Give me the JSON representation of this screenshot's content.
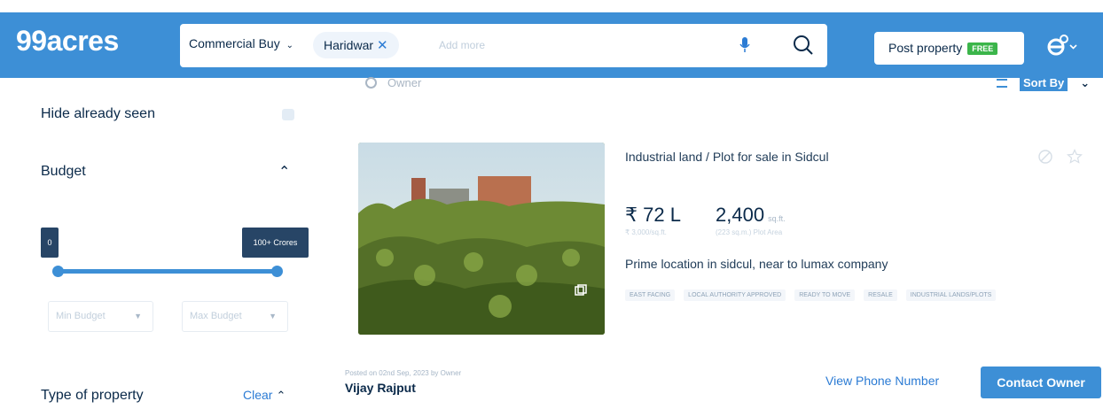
{
  "header": {
    "logo": "99acres",
    "property_type": "Commercial Buy",
    "city_chip": "Haridwar",
    "add_more_placeholder": "Add more",
    "post_property": "Post property",
    "free_badge": "FREE"
  },
  "toolbar": {
    "owner_label": "Owner",
    "sort_by": "Sort By"
  },
  "filters": {
    "hide_seen": "Hide already seen",
    "budget": "Budget",
    "budget_min_tag": "0",
    "budget_max_tag": "100+ Crores",
    "min_budget": "Min Budget",
    "max_budget": "Max Budget",
    "type_of_property": "Type of property",
    "clear": "Clear"
  },
  "listing": {
    "title": "Industrial land / Plot for sale in Sidcul",
    "price": "₹ 72 L",
    "price_per_unit": "₹ 3,000/sq.ft.",
    "area": "2,400",
    "area_unit": "sq.ft.",
    "area_sub": "(223 sq.m.) Plot Area",
    "description": "Prime location in sidcul, near to lumax company",
    "tags": [
      "EAST FACING",
      "LOCAL AUTHORITY APPROVED",
      "READY TO MOVE",
      "RESALE",
      "INDUSTRIAL LANDS/PLOTS"
    ],
    "posted": "Posted on 02nd Sep, 2023 by Owner",
    "poster": "Vijay Rajput",
    "view_phone": "View Phone Number",
    "contact_owner": "Contact Owner"
  },
  "colors": {
    "header_bg": "#3d8fd6",
    "accent": "#2b7bd4",
    "free_badge": "#3bb54a",
    "slider_tag": "#274566"
  }
}
